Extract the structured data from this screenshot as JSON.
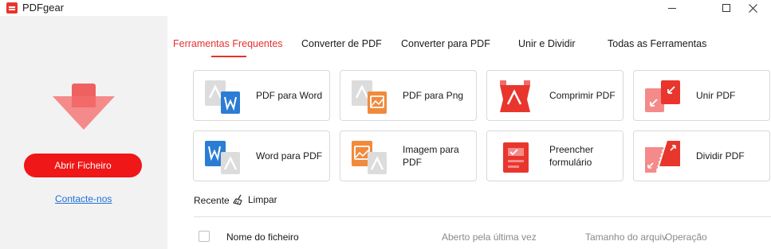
{
  "window": {
    "title": "PDFgear"
  },
  "sidebar": {
    "open_button": "Abrir Ficheiro",
    "contact_link": "Contacte-nos"
  },
  "tabs": [
    {
      "label": "Ferramentas Frequentes",
      "active": true
    },
    {
      "label": "Converter de PDF",
      "active": false
    },
    {
      "label": "Converter para PDF",
      "active": false
    },
    {
      "label": "Unir e Dividir",
      "active": false
    },
    {
      "label": "Todas as Ferramentas",
      "active": false
    }
  ],
  "tools": [
    {
      "label": "PDF para Word",
      "icon": "pdf-to-word-icon"
    },
    {
      "label": "PDF para Png",
      "icon": "pdf-to-png-icon"
    },
    {
      "label": "Comprimir PDF",
      "icon": "compress-pdf-icon"
    },
    {
      "label": "Unir PDF",
      "icon": "merge-pdf-icon"
    },
    {
      "label": "Word para PDF",
      "icon": "word-to-pdf-icon"
    },
    {
      "label": "Imagem para PDF",
      "icon": "image-to-pdf-icon"
    },
    {
      "label": "Preencher formulário",
      "icon": "fill-form-icon"
    },
    {
      "label": "Dividir PDF",
      "icon": "split-pdf-icon"
    }
  ],
  "recent": {
    "label": "Recente",
    "clear_label": "Limpar",
    "columns": {
      "name": "Nome do ficheiro",
      "opened": "Aberto pela última vez",
      "size": "Tamanho do arquiv",
      "operation": "Operação"
    }
  },
  "colors": {
    "accent": "#e5322d",
    "button": "#ef1717",
    "word_blue": "#2b7cd3",
    "image_orange": "#f08a3c"
  }
}
